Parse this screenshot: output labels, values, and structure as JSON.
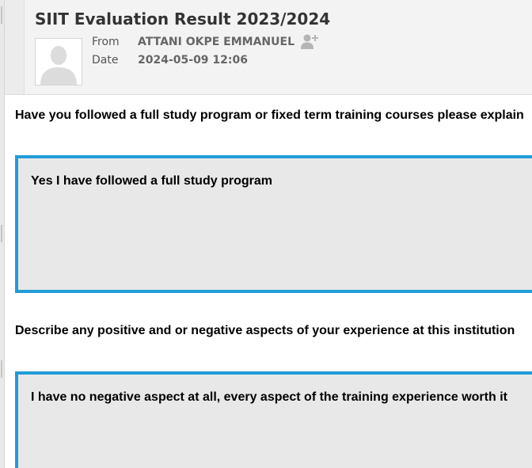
{
  "message": {
    "subject": "SIIT Evaluation Result 2023/2024",
    "from_label": "From",
    "from_value": "ATTANI OKPE EMMANUEL",
    "date_label": "Date",
    "date_value": "2024-05-09 12:06"
  },
  "icons": {
    "avatar": "person-placeholder-icon",
    "add_contact": "add-contact-icon"
  },
  "body": {
    "q1": "Have you followed a full study program or fixed term training courses please explain",
    "a1": "Yes I have followed a full study program",
    "q2": "Describe any positive and or negative aspects of your experience at this institution",
    "a2": "I have no negative aspect at all, every aspect of the training experience worth it"
  },
  "colors": {
    "answer_border": "#219cd8",
    "answer_background": "#e8e8e8",
    "header_background": "#f3f3f3"
  }
}
